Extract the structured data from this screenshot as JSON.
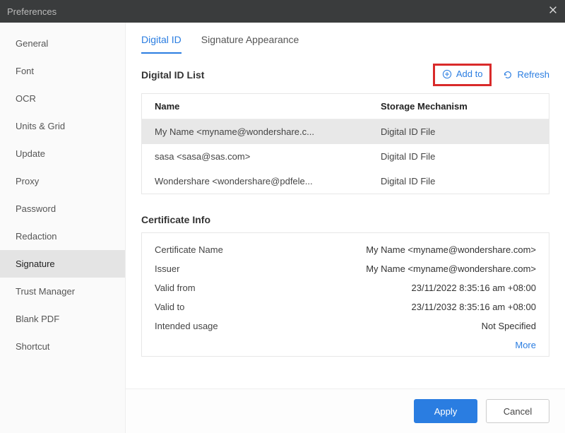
{
  "window": {
    "title": "Preferences"
  },
  "sidebar": {
    "items": [
      {
        "label": "General"
      },
      {
        "label": "Font"
      },
      {
        "label": "OCR"
      },
      {
        "label": "Units & Grid"
      },
      {
        "label": "Update"
      },
      {
        "label": "Proxy"
      },
      {
        "label": "Password"
      },
      {
        "label": "Redaction"
      },
      {
        "label": "Signature",
        "selected": true
      },
      {
        "label": "Trust Manager"
      },
      {
        "label": "Blank PDF"
      },
      {
        "label": "Shortcut"
      }
    ]
  },
  "tabs": [
    {
      "label": "Digital ID",
      "active": true
    },
    {
      "label": "Signature Appearance"
    }
  ],
  "digital_id": {
    "title": "Digital ID List",
    "add_label": "Add to",
    "refresh_label": "Refresh",
    "columns": {
      "name": "Name",
      "storage": "Storage Mechanism"
    },
    "rows": [
      {
        "name": "My Name <myname@wondershare.c...",
        "storage": "Digital ID File",
        "selected": true
      },
      {
        "name": "sasa <sasa@sas.com>",
        "storage": "Digital ID File"
      },
      {
        "name": "Wondershare <wondershare@pdfele...",
        "storage": "Digital ID File"
      }
    ]
  },
  "cert": {
    "title": "Certificate Info",
    "rows": [
      {
        "label": "Certificate Name",
        "value": "My Name <myname@wondershare.com>"
      },
      {
        "label": "Issuer",
        "value": "My Name <myname@wondershare.com>"
      },
      {
        "label": "Valid from",
        "value": "23/11/2022 8:35:16 am +08:00"
      },
      {
        "label": "Valid to",
        "value": "23/11/2032 8:35:16 am +08:00"
      },
      {
        "label": "Intended usage",
        "value": "Not Specified"
      }
    ],
    "more": "More"
  },
  "footer": {
    "apply": "Apply",
    "cancel": "Cancel"
  }
}
